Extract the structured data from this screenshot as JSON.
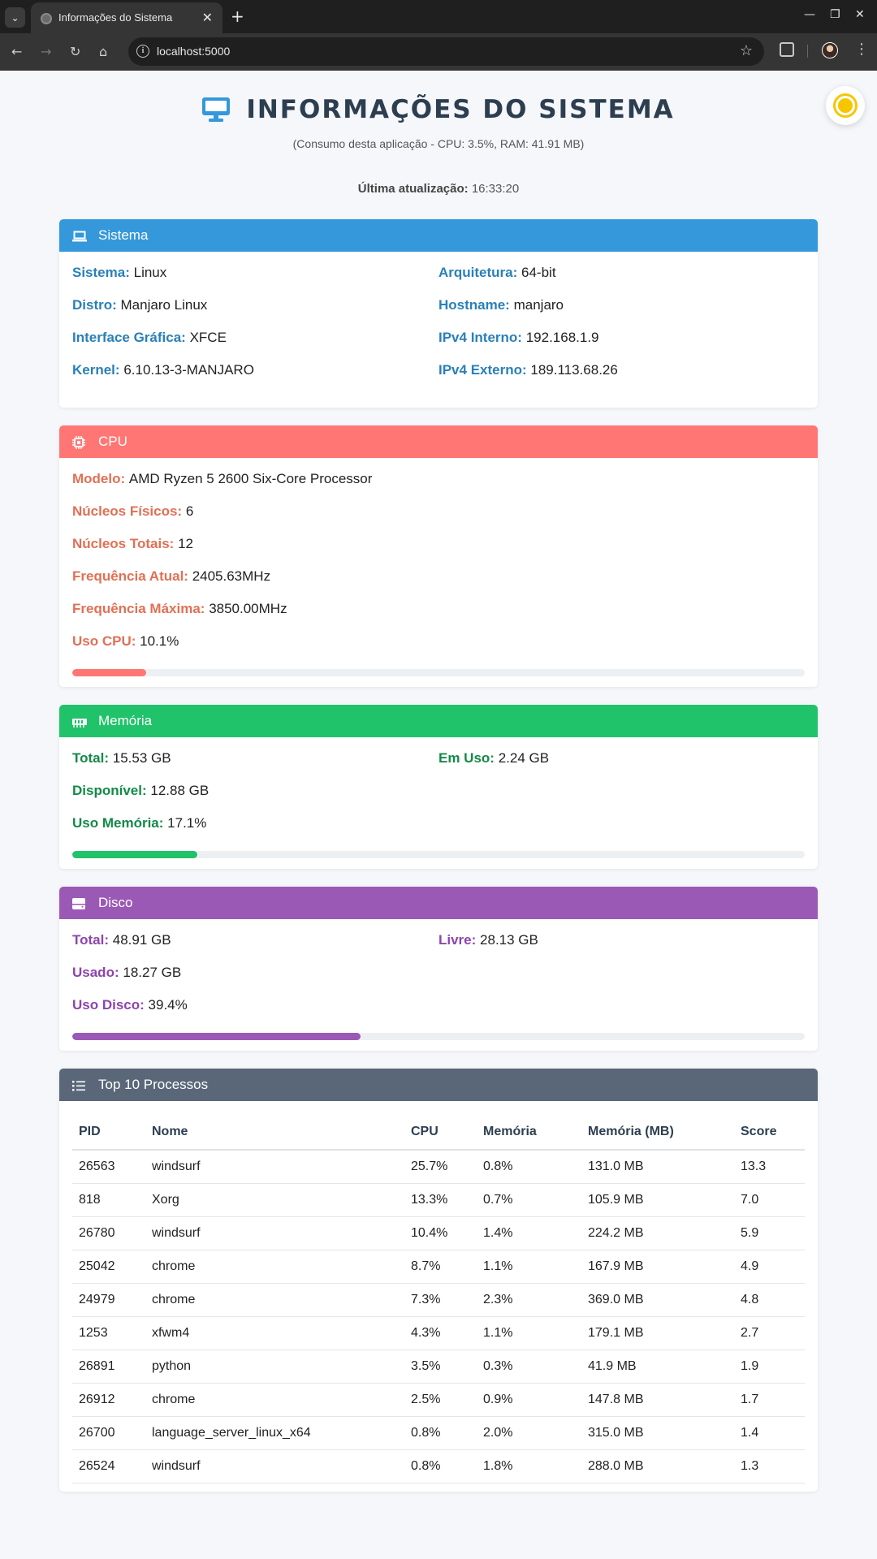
{
  "browser": {
    "tab_title": "Informações do Sistema",
    "url": "localhost:5000"
  },
  "header": {
    "title": "INFORMAÇÕES DO SISTEMA",
    "subtitle": "(Consumo desta aplicação - CPU: 3.5%, RAM: 41.91 MB)",
    "last_update_label": "Última atualização:",
    "last_update_value": "16:33:20"
  },
  "sistema": {
    "title": "Sistema",
    "fields": {
      "sistema": {
        "label": "Sistema:",
        "value": "Linux"
      },
      "arquitetura": {
        "label": "Arquitetura:",
        "value": "64-bit"
      },
      "distro": {
        "label": "Distro:",
        "value": "Manjaro Linux"
      },
      "hostname": {
        "label": "Hostname:",
        "value": "manjaro"
      },
      "interface": {
        "label": "Interface Gráfica:",
        "value": "XFCE"
      },
      "ipv4_interno": {
        "label": "IPv4 Interno:",
        "value": "192.168.1.9"
      },
      "kernel": {
        "label": "Kernel:",
        "value": "6.10.13-3-MANJARO"
      },
      "ipv4_externo": {
        "label": "IPv4 Externo:",
        "value": "189.113.68.26"
      }
    }
  },
  "cpu": {
    "title": "CPU",
    "fields": {
      "modelo": {
        "label": "Modelo:",
        "value": "AMD Ryzen 5 2600 Six-Core Processor"
      },
      "nucleos_fisicos": {
        "label": "Núcleos Físicos:",
        "value": "6"
      },
      "nucleos_totais": {
        "label": "Núcleos Totais:",
        "value": "12"
      },
      "freq_atual": {
        "label": "Frequência Atual:",
        "value": "2405.63MHz"
      },
      "freq_max": {
        "label": "Frequência Máxima:",
        "value": "3850.00MHz"
      },
      "uso": {
        "label": "Uso CPU:",
        "value": "10.1%"
      }
    },
    "usage_percent": 10.1
  },
  "memoria": {
    "title": "Memória",
    "fields": {
      "total": {
        "label": "Total:",
        "value": "15.53 GB"
      },
      "em_uso": {
        "label": "Em Uso:",
        "value": "2.24 GB"
      },
      "disponivel": {
        "label": "Disponível:",
        "value": "12.88 GB"
      },
      "uso": {
        "label": "Uso Memória:",
        "value": "17.1%"
      }
    },
    "usage_percent": 17.1
  },
  "disco": {
    "title": "Disco",
    "fields": {
      "total": {
        "label": "Total:",
        "value": "48.91 GB"
      },
      "livre": {
        "label": "Livre:",
        "value": "28.13 GB"
      },
      "usado": {
        "label": "Usado:",
        "value": "18.27 GB"
      },
      "uso": {
        "label": "Uso Disco:",
        "value": "39.4%"
      }
    },
    "usage_percent": 39.4
  },
  "processos": {
    "title": "Top 10 Processos",
    "columns": [
      "PID",
      "Nome",
      "CPU",
      "Memória",
      "Memória (MB)",
      "Score"
    ],
    "rows": [
      [
        "26563",
        "windsurf",
        "25.7%",
        "0.8%",
        "131.0 MB",
        "13.3"
      ],
      [
        "818",
        "Xorg",
        "13.3%",
        "0.7%",
        "105.9 MB",
        "7.0"
      ],
      [
        "26780",
        "windsurf",
        "10.4%",
        "1.4%",
        "224.2 MB",
        "5.9"
      ],
      [
        "25042",
        "chrome",
        "8.7%",
        "1.1%",
        "167.9 MB",
        "4.9"
      ],
      [
        "24979",
        "chrome",
        "7.3%",
        "2.3%",
        "369.0 MB",
        "4.8"
      ],
      [
        "1253",
        "xfwm4",
        "4.3%",
        "1.1%",
        "179.1 MB",
        "2.7"
      ],
      [
        "26891",
        "python",
        "3.5%",
        "0.3%",
        "41.9 MB",
        "1.9"
      ],
      [
        "26912",
        "chrome",
        "2.5%",
        "0.9%",
        "147.8 MB",
        "1.7"
      ],
      [
        "26700",
        "language_server_linux_x64",
        "0.8%",
        "2.0%",
        "315.0 MB",
        "1.4"
      ],
      [
        "26524",
        "windsurf",
        "0.8%",
        "1.8%",
        "288.0 MB",
        "1.3"
      ]
    ]
  },
  "colors": {
    "sistema": "#3498db",
    "cpu": "#ff7675",
    "memoria": "#20c26a",
    "disco": "#9b59b6",
    "processos": "#596779"
  }
}
